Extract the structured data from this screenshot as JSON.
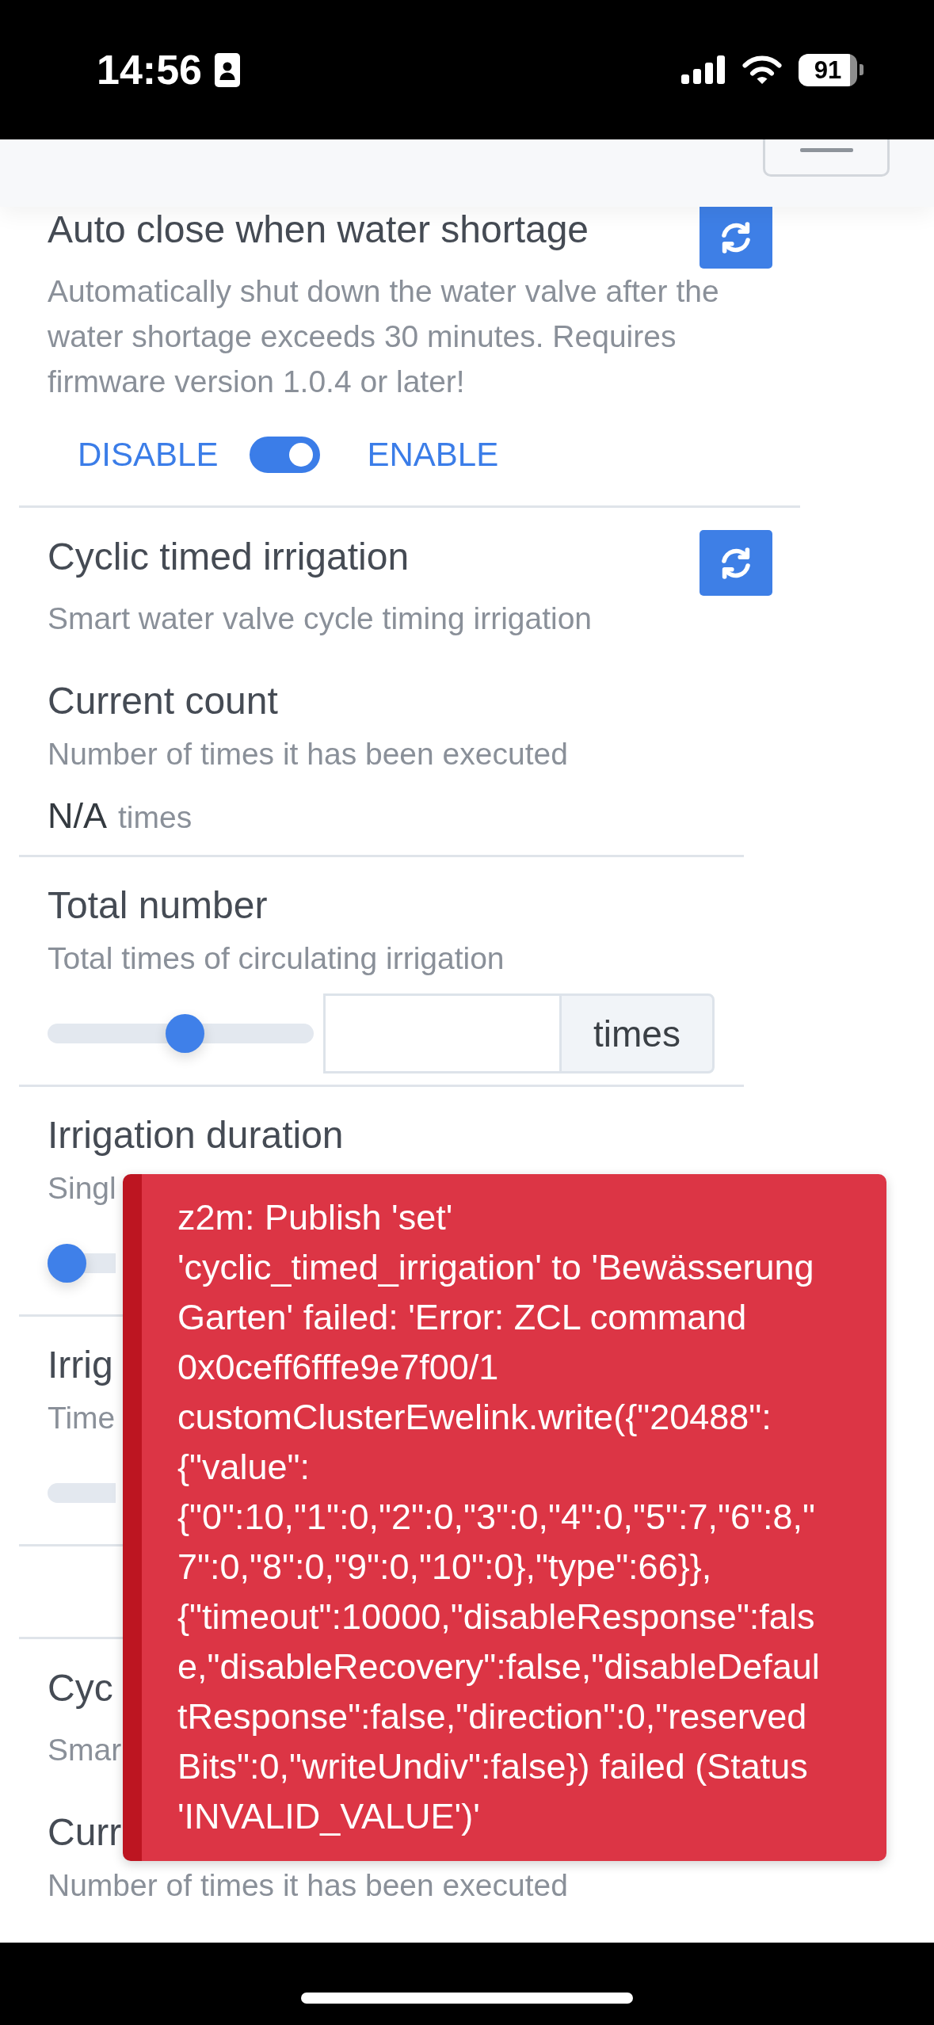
{
  "status_bar": {
    "time": "14:56",
    "battery": "91"
  },
  "groups": [
    {
      "kind": "toggle",
      "title": "Auto close when water shortage",
      "description": "Automatically shut down the water valve after the water shortage exceeds 30 minutes. Requires firmware version 1.0.4 or later!",
      "refresh": true,
      "toggle": {
        "off_label": "DISABLE",
        "on_label": "ENABLE",
        "on": true
      }
    },
    {
      "kind": "fields",
      "title": "Cyclic timed irrigation",
      "description": "Smart water valve cycle timing irrigation",
      "refresh": true,
      "fields": [
        {
          "kind": "reading",
          "label": "Current count",
          "description": "Number of times it has been executed",
          "value": "N/A",
          "unit": "times"
        },
        {
          "kind": "slider",
          "label": "Total number",
          "description": "Total times of circulating irrigation",
          "level": 0.52,
          "unit": "times"
        },
        {
          "kind": "slider",
          "label": "Irrigation duration",
          "description": "Singl",
          "level": 0
        },
        {
          "kind": "slider",
          "label": "Irrig",
          "description": "Time"
        }
      ]
    },
    {
      "kind": "fields",
      "title": "Cyc",
      "description": "Smar",
      "fields": [
        {
          "kind": "reading",
          "label": "Curr",
          "description": "Number of times it has been executed"
        }
      ]
    }
  ],
  "toast": {
    "message": "z2m: Publish 'set' 'cyclic_timed_irrigation' to 'Bewässerung Garten' failed: 'Error: ZCL command 0x0ceff6fffe9e7f00/1 customClusterEwelink.write({\"20488\":{\"value\":{\"0\":10,\"1\":0,\"2\":0,\"3\":0,\"4\":0,\"5\":7,\"6\":8,\"7\":0,\"8\":0,\"9\":0,\"10\":0},\"type\":66}},{\"timeout\":10000,\"disableResponse\":false,\"disableRecovery\":false,\"disableDefaultResponse\":false,\"direction\":0,\"reservedBits\":0,\"writeUndiv\":false}) failed (Status 'INVALID_VALUE')'"
  }
}
